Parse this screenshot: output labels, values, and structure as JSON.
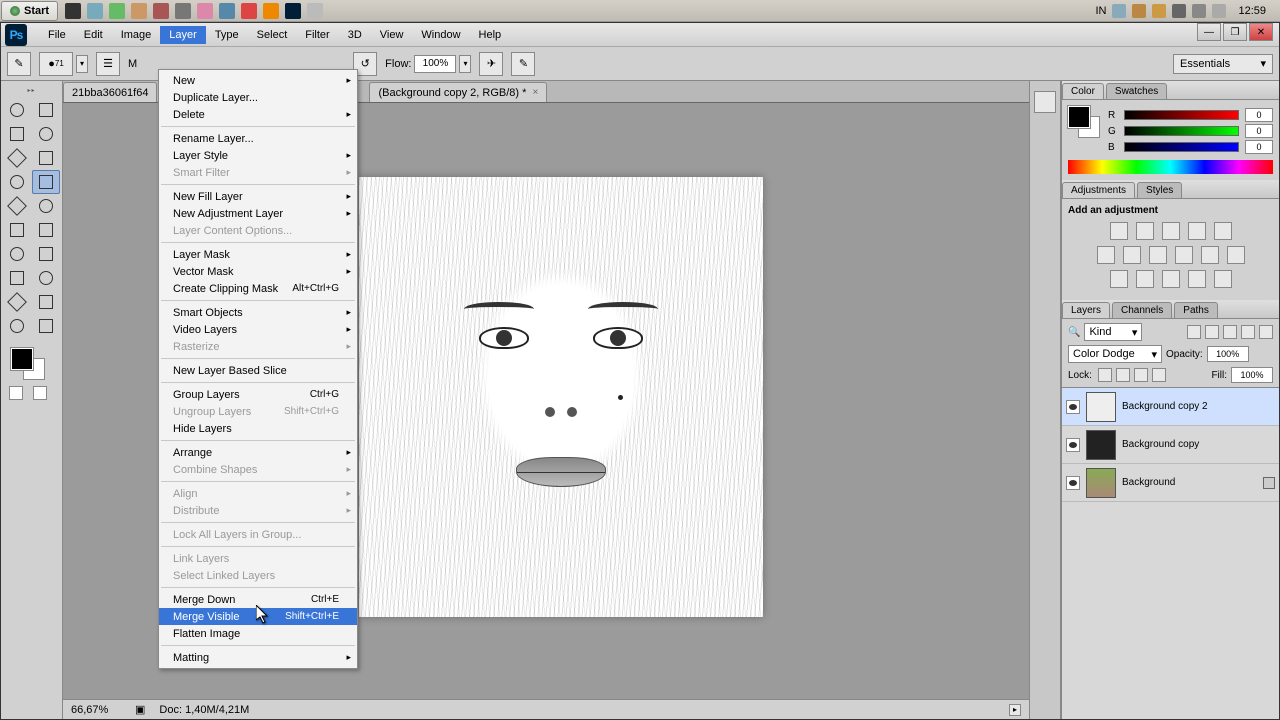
{
  "taskbar": {
    "start": "Start",
    "lang": "IN",
    "clock": "12:59"
  },
  "menubar": {
    "items": [
      "File",
      "Edit",
      "Image",
      "Layer",
      "Type",
      "Select",
      "Filter",
      "3D",
      "View",
      "Window",
      "Help"
    ],
    "open_index": 3
  },
  "options": {
    "size_label": "71",
    "mode_label": "M",
    "flow_label": "Flow:",
    "flow_value": "100%",
    "workspace": "Essentials"
  },
  "doc_tabs": {
    "left": "21bba36061f64",
    "right": "(Background copy 2, RGB/8) *"
  },
  "dropdown": {
    "items": [
      {
        "label": "New",
        "sub": true
      },
      {
        "label": "Duplicate Layer..."
      },
      {
        "label": "Delete",
        "sub": true
      },
      {
        "sep": true
      },
      {
        "label": "Rename Layer..."
      },
      {
        "label": "Layer Style",
        "sub": true
      },
      {
        "label": "Smart Filter",
        "sub": true,
        "disabled": true
      },
      {
        "sep": true
      },
      {
        "label": "New Fill Layer",
        "sub": true
      },
      {
        "label": "New Adjustment Layer",
        "sub": true
      },
      {
        "label": "Layer Content Options...",
        "disabled": true
      },
      {
        "sep": true
      },
      {
        "label": "Layer Mask",
        "sub": true
      },
      {
        "label": "Vector Mask",
        "sub": true
      },
      {
        "label": "Create Clipping Mask",
        "shortcut": "Alt+Ctrl+G"
      },
      {
        "sep": true
      },
      {
        "label": "Smart Objects",
        "sub": true
      },
      {
        "label": "Video Layers",
        "sub": true
      },
      {
        "label": "Rasterize",
        "sub": true,
        "disabled": true
      },
      {
        "sep": true
      },
      {
        "label": "New Layer Based Slice"
      },
      {
        "sep": true
      },
      {
        "label": "Group Layers",
        "shortcut": "Ctrl+G"
      },
      {
        "label": "Ungroup Layers",
        "shortcut": "Shift+Ctrl+G",
        "disabled": true
      },
      {
        "label": "Hide Layers"
      },
      {
        "sep": true
      },
      {
        "label": "Arrange",
        "sub": true
      },
      {
        "label": "Combine Shapes",
        "sub": true,
        "disabled": true
      },
      {
        "sep": true
      },
      {
        "label": "Align",
        "sub": true,
        "disabled": true
      },
      {
        "label": "Distribute",
        "sub": true,
        "disabled": true
      },
      {
        "sep": true
      },
      {
        "label": "Lock All Layers in Group...",
        "disabled": true
      },
      {
        "sep": true
      },
      {
        "label": "Link Layers",
        "disabled": true
      },
      {
        "label": "Select Linked Layers",
        "disabled": true
      },
      {
        "sep": true
      },
      {
        "label": "Merge Down",
        "shortcut": "Ctrl+E"
      },
      {
        "label": "Merge Visible",
        "shortcut": "Shift+Ctrl+E",
        "hl": true
      },
      {
        "label": "Flatten Image"
      },
      {
        "sep": true
      },
      {
        "label": "Matting",
        "sub": true
      }
    ]
  },
  "color_panel": {
    "tabs": [
      "Color",
      "Swatches"
    ],
    "r": "0",
    "g": "0",
    "b": "0",
    "rl": "R",
    "gl": "G",
    "bl": "B"
  },
  "adjustments": {
    "tabs": [
      "Adjustments",
      "Styles"
    ],
    "title": "Add an adjustment"
  },
  "layers_panel": {
    "tabs": [
      "Layers",
      "Channels",
      "Paths"
    ],
    "kind": "Kind",
    "blend": "Color Dodge",
    "opacity_label": "Opacity:",
    "opacity": "100%",
    "lock_label": "Lock:",
    "fill_label": "Fill:",
    "fill": "100%",
    "layers": [
      {
        "name": "Background copy 2",
        "sel": true,
        "thumb": "sketch"
      },
      {
        "name": "Background copy",
        "thumb": "dark"
      },
      {
        "name": "Background",
        "thumb": "color",
        "locked": true
      }
    ]
  },
  "status": {
    "zoom": "66,67%",
    "doc": "Doc: 1,40M/4,21M"
  },
  "window_controls": {
    "min": "—",
    "max": "❐",
    "close": "✕"
  }
}
